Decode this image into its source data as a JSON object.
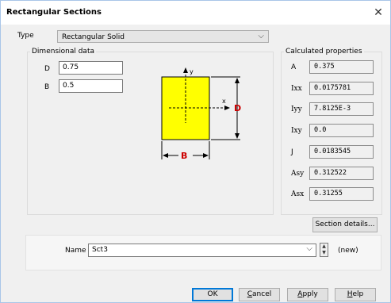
{
  "window": {
    "title": "Rectangular Sections",
    "close_glyph": "✕"
  },
  "type": {
    "label": "Type",
    "value": "Rectangular Solid"
  },
  "dimensional": {
    "legend": "Dimensional data",
    "fields": [
      {
        "label": "D",
        "value": "0.75"
      },
      {
        "label": "B",
        "value": "0.5"
      }
    ]
  },
  "diagram": {
    "y_label": "y",
    "x_label": "x",
    "d_label": "D",
    "b_label": "B",
    "fill_color": "#ffff00",
    "dim_color": "#cc0000"
  },
  "calculated": {
    "legend": "Calculated properties",
    "props": [
      {
        "label": "A",
        "value": "0.375"
      },
      {
        "label": "Ixx",
        "value": "0.0175781"
      },
      {
        "label": "Iyy",
        "value": "7.8125E-3"
      },
      {
        "label": "Ixy",
        "value": "0.0"
      },
      {
        "label": "J",
        "value": "0.0183545"
      },
      {
        "label": "Asy",
        "value": "0.312522"
      },
      {
        "label": "Asx",
        "value": "0.31255"
      }
    ]
  },
  "section_details_button": "Section details...",
  "name": {
    "label": "Name",
    "value": "Sct3",
    "status": "(new)"
  },
  "buttons": {
    "ok": "OK",
    "cancel_first": "C",
    "cancel_rest": "ancel",
    "apply_first": "A",
    "apply_rest": "pply",
    "help_first": "H",
    "help_rest": "elp"
  },
  "icons": {
    "chevron": "chevron-down-icon",
    "close": "close-icon",
    "spin": "spin-arrows-icon"
  }
}
